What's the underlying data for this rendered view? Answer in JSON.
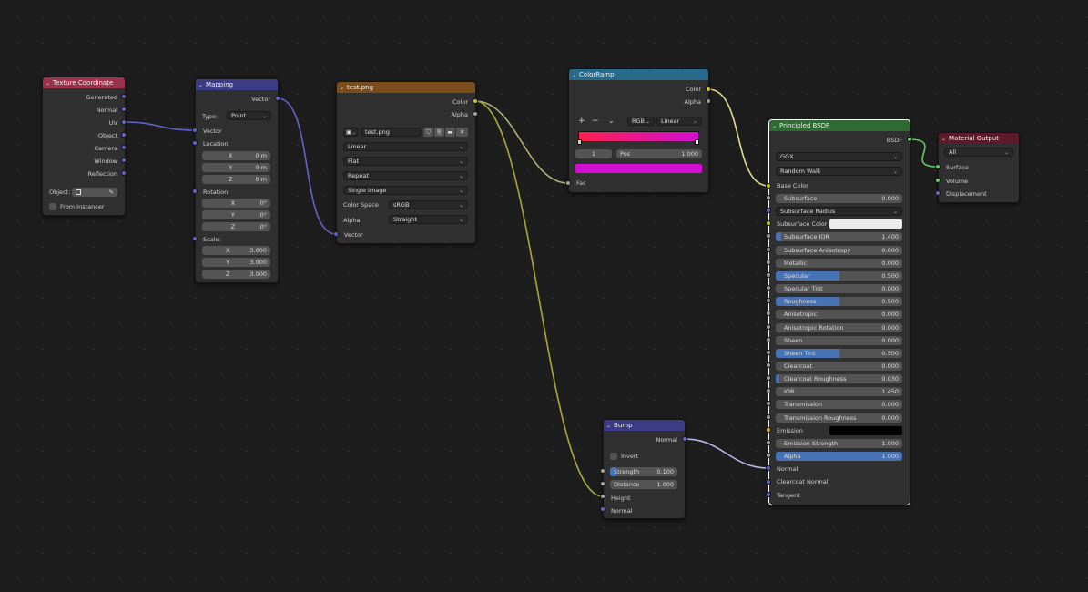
{
  "colors": {
    "texcoord_header": "#9c324b",
    "mapping_header": "#3b3b86",
    "image_header": "#7b4d1d",
    "colorramp_header": "#276a8a",
    "bump_header": "#3b3b86",
    "bsdf_header": "#2f6a32",
    "output_header": "#5c1b28",
    "vector_socket": "#6363c7",
    "color_socket": "#c7c729",
    "float_socket": "#a1a1a1",
    "shader_socket": "#63c763",
    "slider_fill": "#4772b3",
    "ramp_start": "#ff1f4e",
    "ramp_end": "#d20fd2"
  },
  "texcoord": {
    "title": "Texture Coordinate",
    "outputs": [
      "Generated",
      "Normal",
      "UV",
      "Object",
      "Camera",
      "Window",
      "Reflection"
    ],
    "object_label": "Object:",
    "from_instancer": "From Instancer",
    "eyedropper_icon": "eyedropper-icon"
  },
  "mapping": {
    "title": "Mapping",
    "output": "Vector",
    "type_label": "Type:",
    "type_value": "Point",
    "vector_in": "Vector",
    "location_label": "Location:",
    "location": [
      {
        "axis": "X",
        "value": "0 m"
      },
      {
        "axis": "Y",
        "value": "0 m"
      },
      {
        "axis": "Z",
        "value": "0 m"
      }
    ],
    "rotation_label": "Rotation:",
    "rotation": [
      {
        "axis": "X",
        "value": "0°"
      },
      {
        "axis": "Y",
        "value": "0°"
      },
      {
        "axis": "Z",
        "value": "0°"
      }
    ],
    "scale_label": "Scale:",
    "scale": [
      {
        "axis": "X",
        "value": "3.000"
      },
      {
        "axis": "Y",
        "value": "3.000"
      },
      {
        "axis": "Z",
        "value": "3.000"
      }
    ]
  },
  "image": {
    "title": "test.png",
    "out_color": "Color",
    "out_alpha": "Alpha",
    "file": "test.png",
    "interpolation": "Linear",
    "projection": "Flat",
    "extension": "Repeat",
    "source": "Single Image",
    "colorspace_label": "Color Space",
    "colorspace": "sRGB",
    "alpha_label": "Alpha",
    "alpha": "Straight",
    "vector_in": "Vector"
  },
  "colorramp": {
    "title": "ColorRamp",
    "out_color": "Color",
    "out_alpha": "Alpha",
    "plus": "+",
    "minus": "−",
    "chev": "⌄",
    "mode": "RGB",
    "interp": "Linear",
    "index": "1",
    "pos_label": "Pos",
    "pos_value": "1.000",
    "fac_in": "Fac"
  },
  "bump": {
    "title": "Bump",
    "output": "Normal",
    "invert": "Invert",
    "strength_label": "Strength",
    "strength_value": "0.100",
    "strength_fraction": 0.1,
    "distance_label": "Distance",
    "distance_value": "1.000",
    "height_in": "Height",
    "normal_in": "Normal"
  },
  "bsdf": {
    "title": "Principled BSDF",
    "output": "BSDF",
    "distribution": "GGX",
    "subsurface_method": "Random Walk",
    "base_color": "Base Color",
    "params": [
      {
        "label": "Subsurface",
        "value": "0.000",
        "fill": 0
      },
      {
        "label": "Subsurface Radius",
        "dropdown": true
      },
      {
        "label": "Subsurface Color",
        "color": "#ebebeb"
      },
      {
        "label": "Subsurface IOR",
        "value": "1.400",
        "fill": 0.04
      },
      {
        "label": "Subsurface Anisotropy",
        "value": "0.000",
        "fill": 0
      },
      {
        "label": "Metallic",
        "value": "0.000",
        "fill": 0
      },
      {
        "label": "Specular",
        "value": "0.500",
        "fill": 0.5
      },
      {
        "label": "Specular Tint",
        "value": "0.000",
        "fill": 0
      },
      {
        "label": "Roughness",
        "value": "0.500",
        "fill": 0.5
      },
      {
        "label": "Anisotropic",
        "value": "0.000",
        "fill": 0
      },
      {
        "label": "Anisotropic Rotation",
        "value": "0.000",
        "fill": 0
      },
      {
        "label": "Sheen",
        "value": "0.000",
        "fill": 0
      },
      {
        "label": "Sheen Tint",
        "value": "0.500",
        "fill": 0.5
      },
      {
        "label": "Clearcoat",
        "value": "0.000",
        "fill": 0
      },
      {
        "label": "Clearcoat Roughness",
        "value": "0.030",
        "fill": 0.03
      },
      {
        "label": "IOR",
        "value": "1.450",
        "fill": 0
      },
      {
        "label": "Transmission",
        "value": "0.000",
        "fill": 0
      },
      {
        "label": "Transmission Roughness",
        "value": "0.000",
        "fill": 0
      },
      {
        "label": "Emission",
        "color": "#000000"
      },
      {
        "label": "Emission Strength",
        "value": "1.000",
        "fill": 0
      },
      {
        "label": "Alpha",
        "value": "1.000",
        "fill": 1
      }
    ],
    "normal_in": "Normal",
    "clearcoat_normal_in": "Clearcoat Normal",
    "tangent_in": "Tangent"
  },
  "output": {
    "title": "Material Output",
    "target": "All",
    "inputs": [
      "Surface",
      "Volume",
      "Displacement"
    ]
  }
}
